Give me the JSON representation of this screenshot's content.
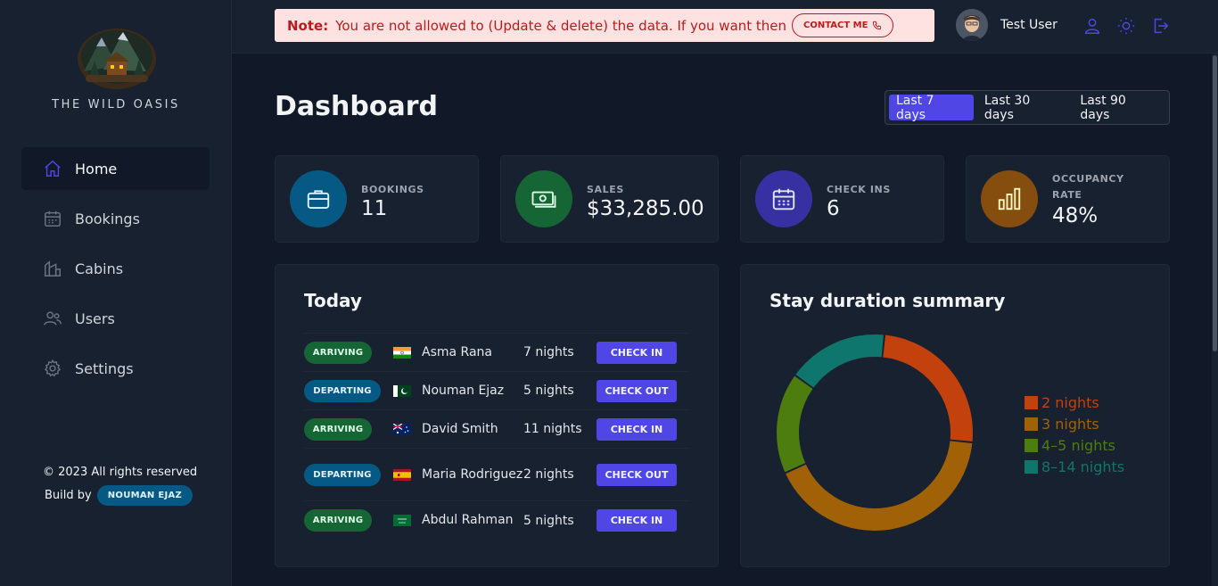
{
  "sidebar": {
    "brand": "THE WILD OASIS",
    "items": [
      {
        "label": "Home"
      },
      {
        "label": "Bookings"
      },
      {
        "label": "Cabins"
      },
      {
        "label": "Users"
      },
      {
        "label": "Settings"
      }
    ],
    "copyright": "© 2023 All rights reserved",
    "build_prefix": "Build by",
    "build_name": "NOUMAN EJAZ"
  },
  "header": {
    "note_label": "Note:",
    "note_text": "You are not allowed to (Update & delete) the data. If you want then",
    "contact_label": "CONTACT ME",
    "user_name": "Test User",
    "icons": [
      "user-icon",
      "sun-icon",
      "logout-icon"
    ]
  },
  "main": {
    "title": "Dashboard",
    "filters": [
      "Last 7 days",
      "Last 30 days",
      "Last 90 days"
    ],
    "active_filter": "Last 7 days",
    "stats": [
      {
        "label": "BOOKINGS",
        "value": "11",
        "icon": "briefcase-icon",
        "color": "#075985"
      },
      {
        "label": "SALES",
        "value": "$33,285.00",
        "icon": "banknotes-icon",
        "color": "#166534"
      },
      {
        "label": "CHECK INS",
        "value": "6",
        "icon": "calendar-icon",
        "color": "#3730a3"
      },
      {
        "label": "OCCUPANCY RATE",
        "value": "48%",
        "icon": "chart-bar-icon",
        "color": "#854d0e"
      }
    ],
    "today": {
      "title": "Today",
      "rows": [
        {
          "status": "ARRIVING",
          "flag": "india",
          "guest": "Asma Rana",
          "nights": "7 nights",
          "action": "CHECK IN"
        },
        {
          "status": "DEPARTING",
          "flag": "pakistan",
          "guest": "Nouman Ejaz",
          "nights": "5 nights",
          "action": "CHECK OUT"
        },
        {
          "status": "ARRIVING",
          "flag": "australia",
          "guest": "David Smith",
          "nights": "11 nights",
          "action": "CHECK IN"
        },
        {
          "status": "DEPARTING",
          "flag": "spain",
          "guest": "Maria Rodriguez",
          "nights": "2 nights",
          "action": "CHECK OUT"
        },
        {
          "status": "ARRIVING",
          "flag": "saudi-arabia",
          "guest": "Abdul Rahman",
          "nights": "5 nights",
          "action": "CHECK IN"
        }
      ]
    },
    "duration": {
      "title": "Stay duration summary"
    }
  },
  "chart_data": {
    "type": "pie",
    "title": "Stay duration summary",
    "categories": [
      "2 nights",
      "3 nights",
      "4-5 nights",
      "8-14 nights"
    ],
    "values": [
      3,
      5,
      2,
      2
    ],
    "legend_labels": [
      "2 nights",
      "3 nights",
      "4–5 nights",
      "8–14 nights"
    ],
    "colors": [
      "#c2410c",
      "#a16207",
      "#4d7c0f",
      "#0f766e"
    ],
    "legend": "right"
  }
}
